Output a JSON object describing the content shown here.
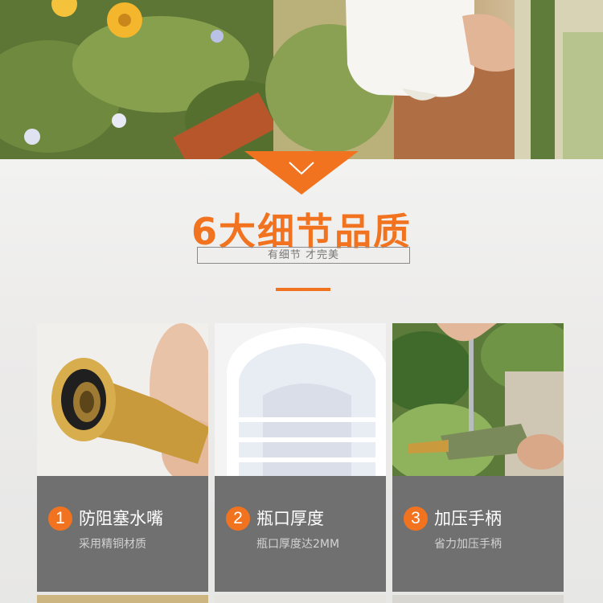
{
  "section": {
    "headline": "6大细节品质",
    "tagline": "有细节 才完美"
  },
  "colors": {
    "accent": "#f2731f",
    "card_bg": "#707070"
  },
  "cards": [
    {
      "number": "1",
      "title": "防阻塞水嘴",
      "desc": "采用精铜材质"
    },
    {
      "number": "2",
      "title": "瓶口厚度",
      "desc": "瓶口厚度达2MM"
    },
    {
      "number": "3",
      "title": "加压手柄",
      "desc": "省力加压手柄"
    }
  ]
}
